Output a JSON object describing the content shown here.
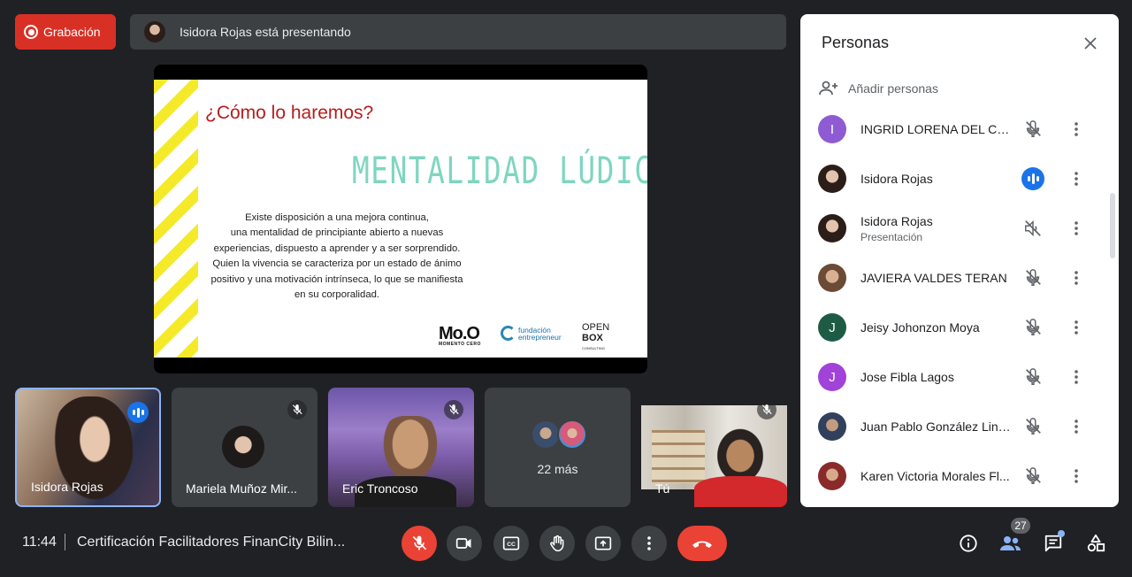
{
  "recording": {
    "label": "Grabación"
  },
  "presenting": {
    "text": "Isidora Rojas está presentando"
  },
  "slide": {
    "question": "¿Cómo lo haremos?",
    "title": "MENTALIDAD LÚDICA",
    "body_lines": [
      "Existe disposición a una mejora continua,",
      "una mentalidad de principiante abierto a nuevas",
      "experiencias, dispuesto a aprender y a ser sorprendido.",
      "Quien la vivencia se caracteriza por un estado de ánimo",
      "positivo y una motivación intrínseca, lo que se manifiesta",
      "en su corporalidad."
    ],
    "logo_mo": "Mo.O",
    "logo_mo_sub": "MOMENTO CERO",
    "logo_fund_1": "fundación",
    "logo_fund_2": "entrepreneur",
    "logo_open_1": "OPEN",
    "logo_open_2": "BOX",
    "logo_open_3": "CONSULTING"
  },
  "tiles": [
    {
      "name": "Isidora Rojas"
    },
    {
      "name": "Mariela Muñoz Mir..."
    },
    {
      "name": "Eric Troncoso"
    },
    {
      "name": "22 más"
    },
    {
      "name": "Tú"
    }
  ],
  "panel": {
    "title": "Personas",
    "add_label": "Añadir personas",
    "people": [
      {
        "name": "INGRID LORENA DEL CAR...",
        "initial": "I",
        "color": "#8e5bd2",
        "status": "muted"
      },
      {
        "name": "Isidora Rojas",
        "status": "speaking"
      },
      {
        "name": "Isidora Rojas",
        "sub": "Presentación",
        "status": "audio-off"
      },
      {
        "name": "JAVIERA VALDES TERAN",
        "status": "muted"
      },
      {
        "name": "Jeisy Johonzon Moya",
        "initial": "J",
        "color": "#1e5b45",
        "status": "muted"
      },
      {
        "name": "Jose Fibla Lagos",
        "initial": "J",
        "color": "#a142d8",
        "status": "muted"
      },
      {
        "name": "Juan Pablo González Line...",
        "status": "muted"
      },
      {
        "name": "Karen Victoria Morales Fl...",
        "status": "muted"
      }
    ]
  },
  "bottom": {
    "time": "11:44",
    "meeting_title": "Certificación Facilitadores FinanCity Bilin...",
    "participant_count": "27"
  },
  "colors": {
    "accent": "#1a73e8",
    "danger": "#ea4335",
    "recording": "#d93025"
  }
}
